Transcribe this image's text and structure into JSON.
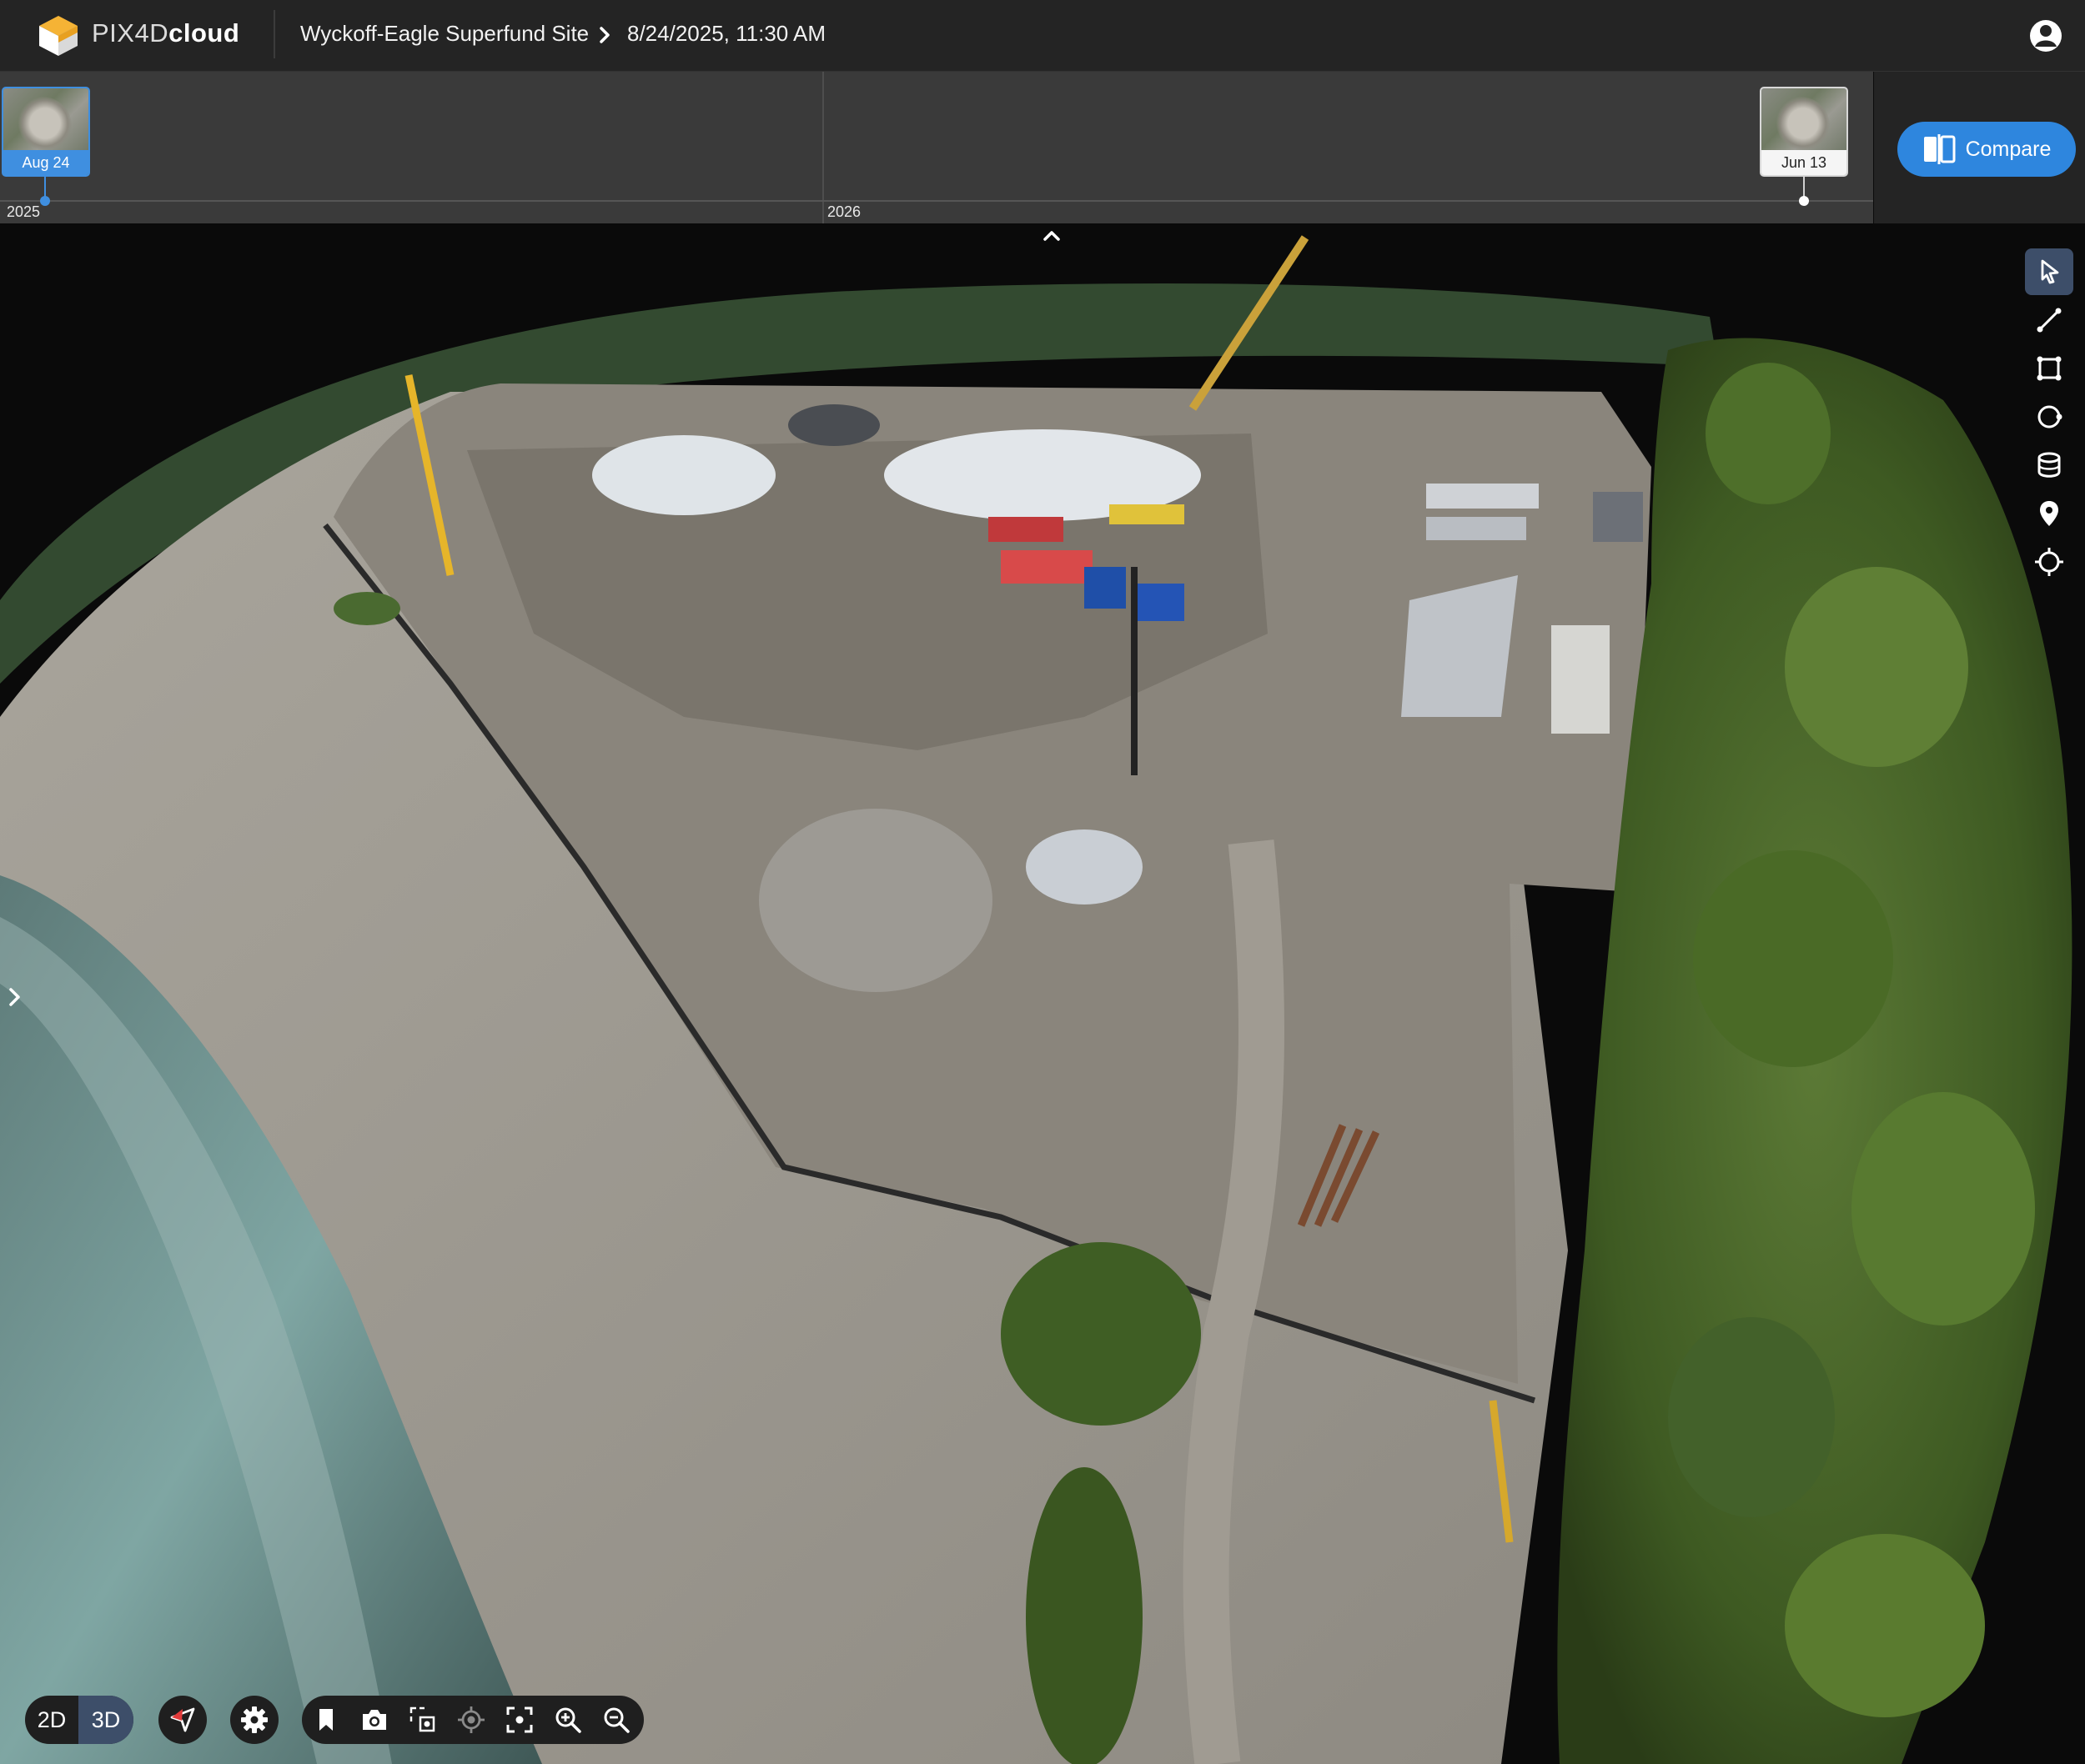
{
  "app": {
    "brand_light": "PIX4D",
    "brand_bold": "cloud"
  },
  "breadcrumb": {
    "project": "Wyckoff-Eagle Superfund Site",
    "dataset": "8/24/2025, 11:30 AM"
  },
  "timeline": {
    "years": [
      "2025",
      "2026"
    ],
    "captures": [
      {
        "label": "Aug 24",
        "selected": true
      },
      {
        "label": "Jun 13",
        "selected": false
      }
    ]
  },
  "compare": {
    "label": "Compare"
  },
  "view_mode": {
    "options": [
      "2D",
      "3D"
    ],
    "active": "3D"
  },
  "tools": {
    "right_rail": [
      "select-icon",
      "polyline-icon",
      "polygon-icon",
      "circle-icon",
      "volume-icon",
      "marker-icon",
      "crosshair-icon"
    ],
    "bottom": [
      "navigate-icon",
      "settings-icon",
      "bookmark-icon",
      "camera-icon",
      "fit-view-icon",
      "locate-icon",
      "focus-icon",
      "zoom-in-icon",
      "zoom-out-icon"
    ]
  },
  "colors": {
    "accent": "#2e86de",
    "active_tool": "#3d4e69",
    "topbar": "#242424",
    "timeline": "#3a3a3a"
  }
}
